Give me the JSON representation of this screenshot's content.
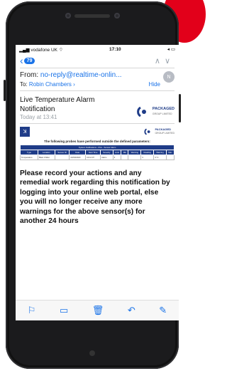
{
  "colors": {
    "accent": "#1a73e8",
    "brand_blue": "#1f3c88",
    "corner_red": "#e2001a"
  },
  "status_bar": {
    "carrier": "vodafone UK",
    "time": "17:10"
  },
  "nav": {
    "back_badge": "79"
  },
  "header": {
    "from_label": "From:",
    "from_value": "no-reply@realtime-onlin...",
    "to_label": "To:",
    "to_value": "Robin Chambers",
    "hide_label": "Hide",
    "avatar_initial": "N"
  },
  "message": {
    "subject": "Live Temperature Alarm Notification",
    "date": "Today at 13:41",
    "logo_name": "PACKAGED",
    "logo_sub": "GROUP LIMITED",
    "inner_logo_name": "PACKAGED",
    "inner_logo_sub": "GROUP LIMITED",
    "probe_heading": "The following probes have performed outside the defined parameters:",
    "table": {
      "banner": "System Notifications - PGL - Sensor Alarm",
      "columns": [
        "Type",
        "Location",
        "Sensor ID",
        "Date",
        "Start Time",
        "Severity",
        "Limit",
        "Min",
        "Warning",
        "Reading",
        "Warning",
        "Max"
      ],
      "row": [
        "Temperature",
        "Blast Chiller",
        "",
        "22/03/2023",
        "13:12:07",
        "Alarm",
        "3",
        "",
        "",
        "3",
        "4 °C",
        ""
      ]
    },
    "body_text": "Please record your actions and any remedial work regarding this notification by logging into your online web portal, else you will no longer receive any more warnings for the above sensor(s) for another 24 hours"
  },
  "toolbar_icons": [
    "flag-icon",
    "folder-icon",
    "trash-icon",
    "reply-icon",
    "compose-icon"
  ]
}
